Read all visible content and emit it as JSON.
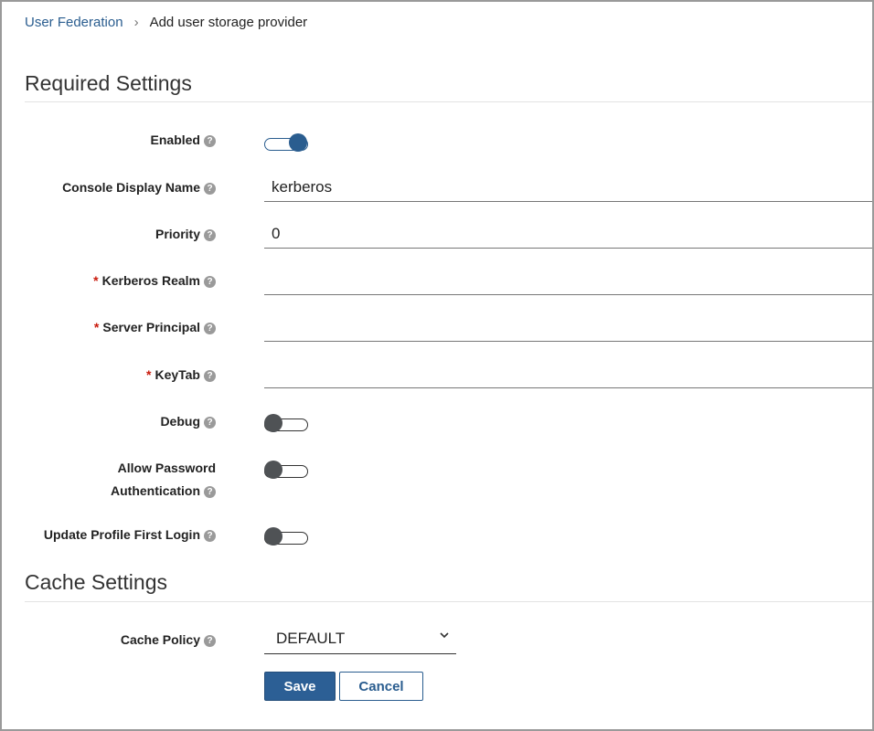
{
  "breadcrumb": {
    "parent": "User Federation",
    "separator": "›",
    "current": "Add user storage provider"
  },
  "sections": {
    "required": "Required Settings",
    "cache": "Cache Settings"
  },
  "help_glyph": "?",
  "required_marker": "*",
  "fields": {
    "enabled": {
      "label": "Enabled",
      "state": "on"
    },
    "console_display_name": {
      "label": "Console Display Name",
      "value": "kerberos"
    },
    "priority": {
      "label": "Priority",
      "value": "0"
    },
    "kerberos_realm": {
      "label": "Kerberos Realm",
      "value": "",
      "required": true
    },
    "server_principal": {
      "label": "Server Principal",
      "value": "",
      "required": true
    },
    "keytab": {
      "label": "KeyTab",
      "value": "",
      "required": true
    },
    "debug": {
      "label": "Debug",
      "state": "off"
    },
    "allow_password_auth": {
      "label_line1": "Allow Password",
      "label_line2": "Authentication",
      "state": "off"
    },
    "update_profile_first_login": {
      "label": "Update Profile First Login",
      "state": "off"
    },
    "cache_policy": {
      "label": "Cache Policy",
      "value": "DEFAULT"
    }
  },
  "buttons": {
    "save": "Save",
    "cancel": "Cancel"
  },
  "colors": {
    "accent": "#2a5d8f",
    "required": "#c9190b",
    "toggle_off_knob": "#4f5255"
  },
  "icons": {
    "help": "help-circle-icon",
    "select": "chevron-down-icon",
    "breadcrumb": "chevron-right-icon"
  }
}
